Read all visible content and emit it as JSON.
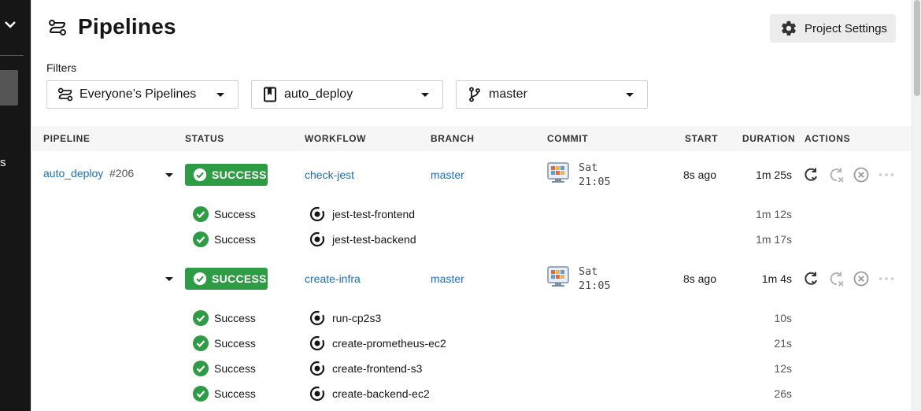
{
  "leftnav": {
    "cut_label": "s"
  },
  "header": {
    "title": "Pipelines",
    "settings_label": "Project Settings"
  },
  "filters": {
    "label": "Filters",
    "pipelines": "Everyone’s Pipelines",
    "project": "auto_deploy",
    "branch": "master"
  },
  "table": {
    "headers": {
      "pipeline": "PIPELINE",
      "status": "STATUS",
      "workflow": "WORKFLOW",
      "branch": "BRANCH",
      "commit": "COMMIT",
      "start": "START",
      "duration": "DURATION",
      "actions": "ACTIONS"
    },
    "pipeline": {
      "name": "auto_deploy",
      "number": "#206"
    },
    "workflows": [
      {
        "status": "SUCCESS",
        "name": "check-jest",
        "branch": "master",
        "commit_day": "Sat",
        "commit_time": "21:05",
        "start": "8s ago",
        "duration": "1m 25s",
        "jobs": [
          {
            "status": "Success",
            "name": "jest-test-frontend",
            "duration": "1m 12s"
          },
          {
            "status": "Success",
            "name": "jest-test-backend",
            "duration": "1m 17s"
          }
        ]
      },
      {
        "status": "SUCCESS",
        "name": "create-infra",
        "branch": "master",
        "commit_day": "Sat",
        "commit_time": "21:05",
        "start": "8s ago",
        "duration": "1m 4s",
        "jobs": [
          {
            "status": "Success",
            "name": "run-cp2s3",
            "duration": "10s"
          },
          {
            "status": "Success",
            "name": "create-prometheus-ec2",
            "duration": "21s"
          },
          {
            "status": "Success",
            "name": "create-frontend-s3",
            "duration": "12s"
          },
          {
            "status": "Success",
            "name": "create-backend-ec2",
            "duration": "26s"
          }
        ]
      }
    ]
  },
  "icons": {
    "header": "pipelines-icon",
    "settings": "gear-icon",
    "success": "check-circle-icon",
    "job": "job-icon",
    "rerun": "rerun-icon",
    "rerun_failed": "rerun-failed-icon",
    "cancel": "cancel-icon",
    "more": "more-icon",
    "branch": "git-branch-icon",
    "project": "bookmark-icon"
  },
  "colors": {
    "success": "#2e9c44",
    "link": "#1f6fb2",
    "nav": "#161616"
  }
}
